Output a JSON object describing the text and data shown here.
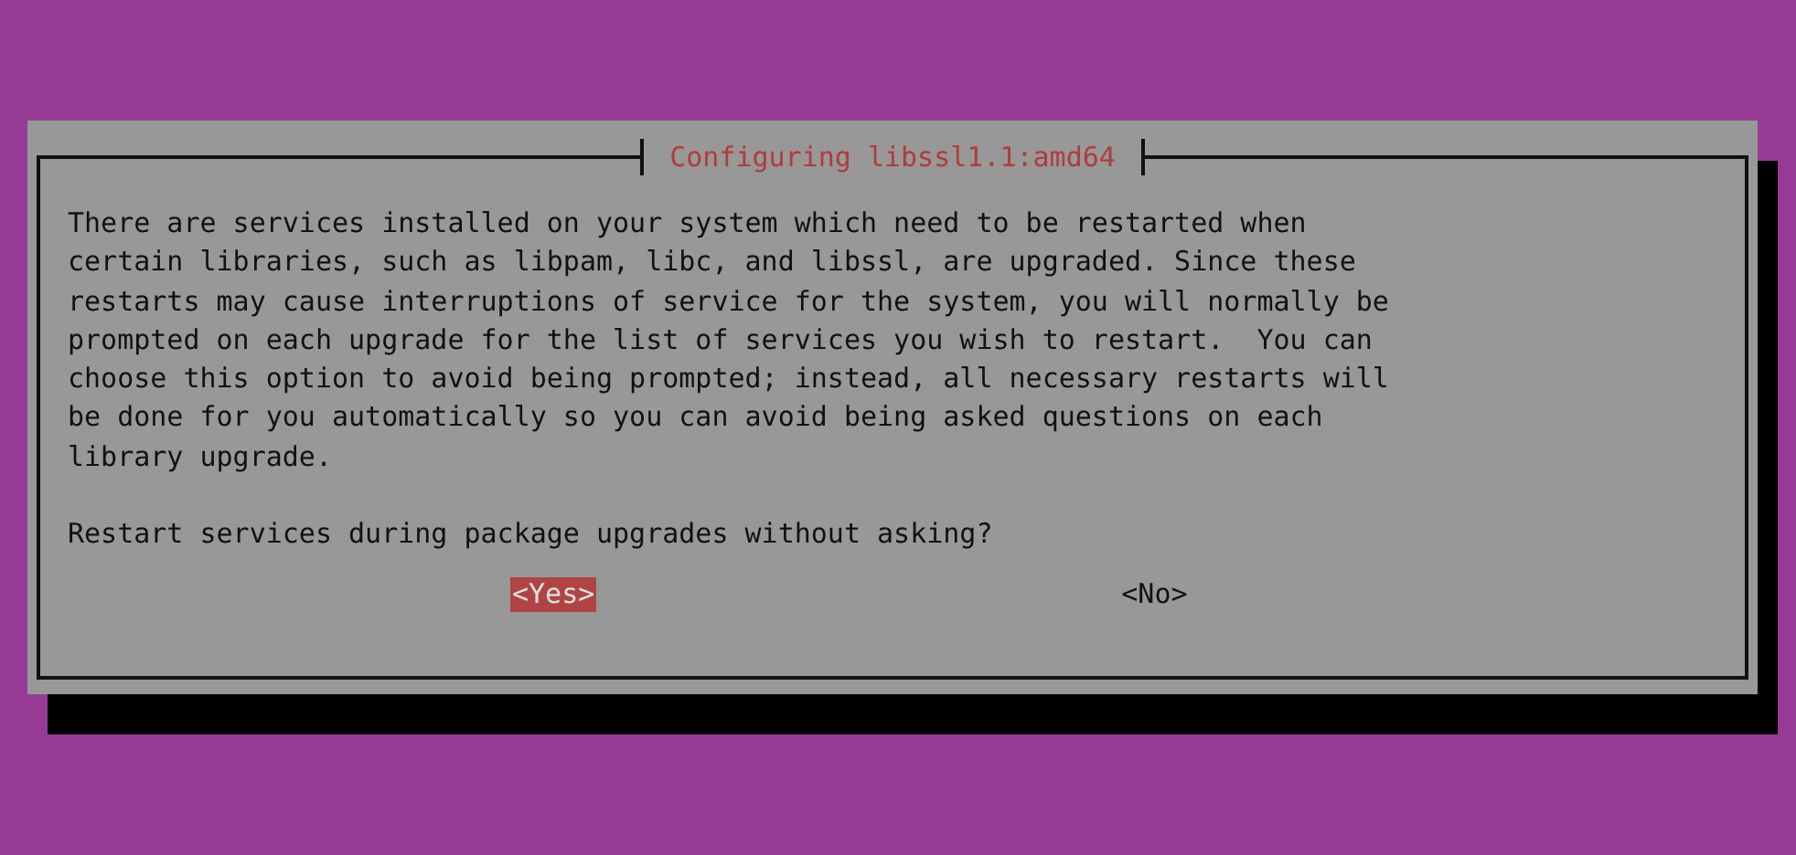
{
  "dialog": {
    "title": "Configuring libssl1.1:amd64",
    "message": "There are services installed on your system which need to be restarted when\ncertain libraries, such as libpam, libc, and libssl, are upgraded. Since these\nrestarts may cause interruptions of service for the system, you will normally be\nprompted on each upgrade for the list of services you wish to restart.  You can\nchoose this option to avoid being prompted; instead, all necessary restarts will\nbe done for you automatically so you can avoid being asked questions on each\nlibrary upgrade.",
    "question": "Restart services during package upgrades without asking?",
    "buttons": [
      {
        "label": "<Yes>",
        "selected": true
      },
      {
        "label": "<No>",
        "selected": false
      }
    ]
  }
}
